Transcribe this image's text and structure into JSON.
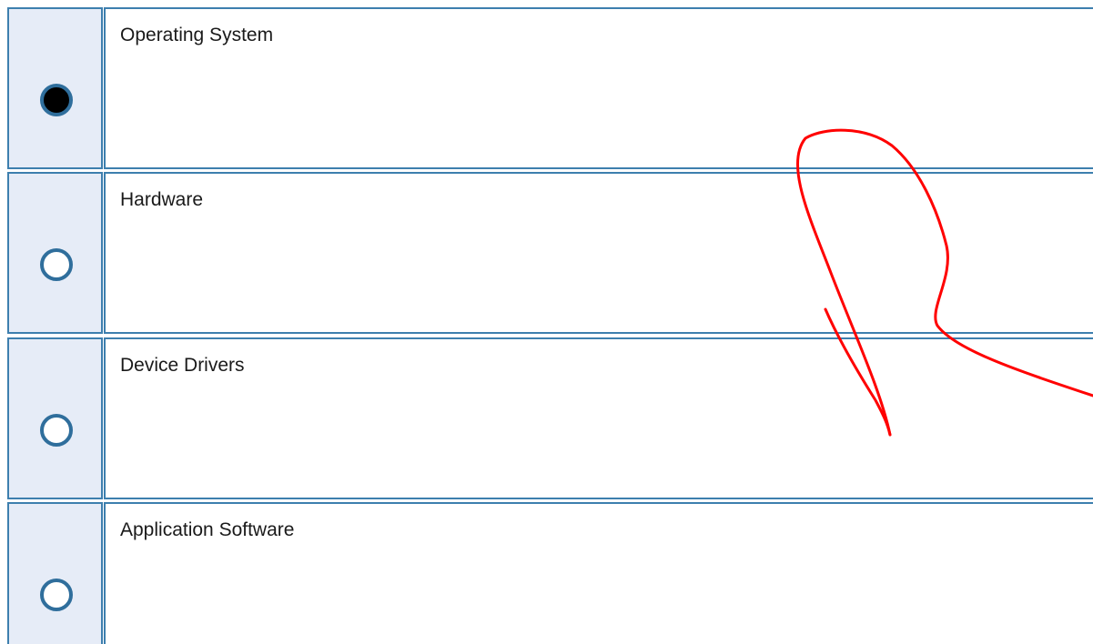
{
  "question": {
    "selected_index": 0,
    "options": [
      {
        "label": "Operating System",
        "checked": true
      },
      {
        "label": "Hardware",
        "checked": false
      },
      {
        "label": "Device Drivers",
        "checked": false
      },
      {
        "label": "Application Software",
        "checked": false
      }
    ]
  },
  "colors": {
    "border": "#3d7fae",
    "radio_cell_bg": "#e6ecf7",
    "radio_border": "#2f6e9c",
    "annotation_stroke": "#ff0000"
  },
  "annotation": {
    "icon": "handwritten-checkmark-icon"
  }
}
